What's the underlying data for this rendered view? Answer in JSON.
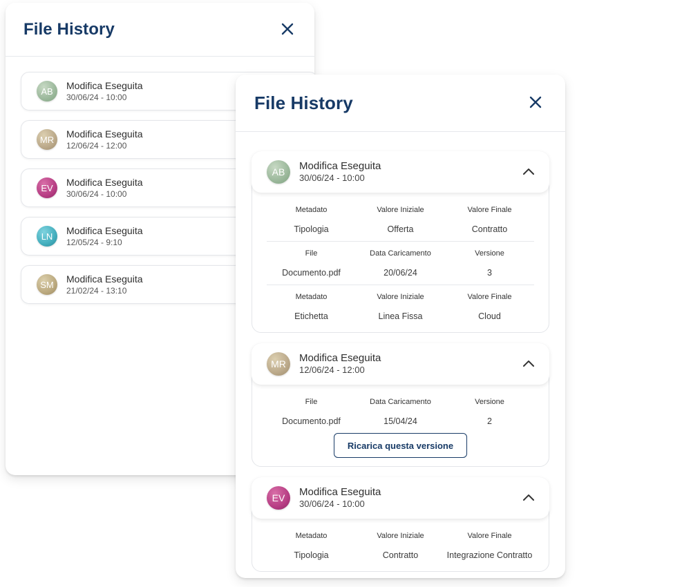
{
  "back_panel": {
    "title": "File History",
    "items": [
      {
        "initials": "AB",
        "title": "Modifica Eseguita",
        "date": "30/06/24 - 10:00"
      },
      {
        "initials": "MR",
        "title": "Modifica Eseguita",
        "date": "12/06/24 - 12:00"
      },
      {
        "initials": "EV",
        "title": "Modifica Eseguita",
        "date": "30/06/24 - 10:00"
      },
      {
        "initials": "LN",
        "title": "Modifica Eseguita",
        "date": "12/05/24 - 9:10"
      },
      {
        "initials": "SM",
        "title": "Modifica Eseguita",
        "date": "21/02/24 - 13:10"
      }
    ]
  },
  "front_panel": {
    "title": "File History",
    "cards": [
      {
        "initials": "AB",
        "title": "Modifica Eseguita",
        "date": "30/06/24 - 10:00",
        "rows": [
          {
            "headers": [
              "Metadato",
              "Valore Iniziale",
              "Valore Finale"
            ],
            "values": [
              "Tipologia",
              "Offerta",
              "Contratto"
            ]
          },
          {
            "headers": [
              "File",
              "Data Caricamento",
              "Versione"
            ],
            "values": [
              "Documento.pdf",
              "20/06/24",
              "3"
            ]
          },
          {
            "headers": [
              "Metadato",
              "Valore Iniziale",
              "Valore Finale"
            ],
            "values": [
              "Etichetta",
              "Linea Fissa",
              "Cloud"
            ]
          }
        ]
      },
      {
        "initials": "MR",
        "title": "Modifica Eseguita",
        "date": "12/06/24 - 12:00",
        "rows": [
          {
            "headers": [
              "File",
              "Data Caricamento",
              "Versione"
            ],
            "values": [
              "Documento.pdf",
              "15/04/24",
              "2"
            ]
          }
        ],
        "button_label": "Ricarica questa versione"
      },
      {
        "initials": "EV",
        "title": "Modifica Eseguita",
        "date": "30/06/24 - 10:00",
        "rows": [
          {
            "headers": [
              "Metadato",
              "Valore Iniziale",
              "Valore Finale"
            ],
            "values": [
              "Tipologia",
              "Contratto",
              "Integrazione Contratto"
            ]
          }
        ]
      }
    ]
  },
  "colors": {
    "brand": "#173a66",
    "border": "#e4e6ea"
  },
  "icons": {
    "close": "close-icon",
    "collapse": "chevron-up-icon"
  }
}
